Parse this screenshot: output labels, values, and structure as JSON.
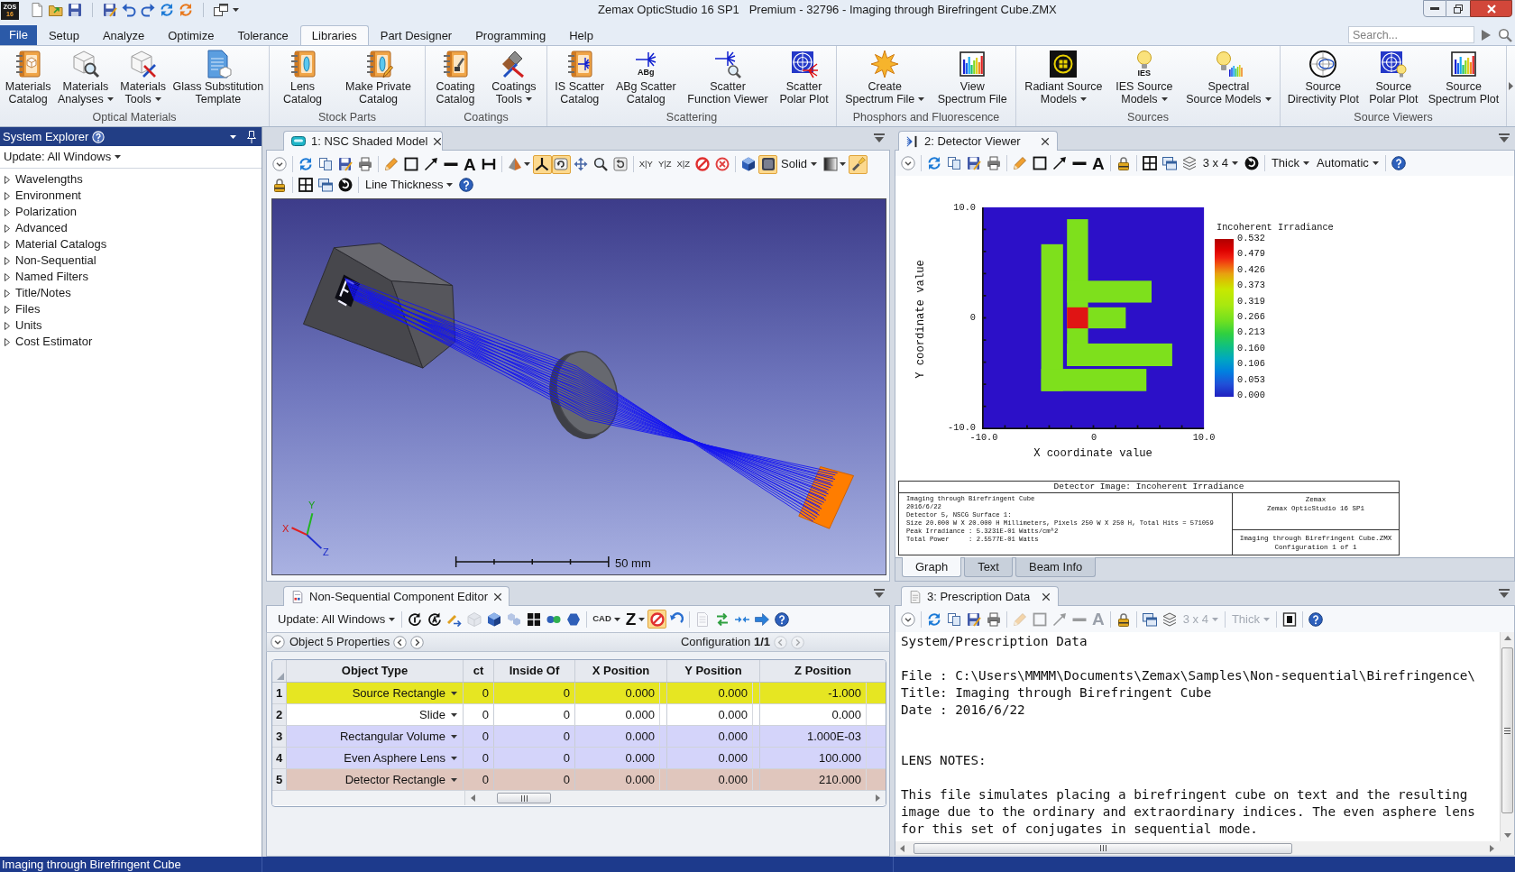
{
  "title_bar": {
    "logo": [
      "ZOS",
      "16"
    ],
    "title": "Zemax OpticStudio 16 SP1   Premium - 32796 - Imaging through Birefringent Cube.ZMX"
  },
  "menu_tabs": [
    {
      "label": "File",
      "kind": "file",
      "selected": false
    },
    {
      "label": "Setup",
      "kind": "tab",
      "selected": false
    },
    {
      "label": "Analyze",
      "kind": "tab",
      "selected": false
    },
    {
      "label": "Optimize",
      "kind": "tab",
      "selected": false
    },
    {
      "label": "Tolerance",
      "kind": "tab",
      "selected": false
    },
    {
      "label": "Libraries",
      "kind": "tab",
      "selected": true
    },
    {
      "label": "Part Designer",
      "kind": "tab",
      "selected": false
    },
    {
      "label": "Programming",
      "kind": "tab",
      "selected": false
    },
    {
      "label": "Help",
      "kind": "tab",
      "selected": false
    }
  ],
  "search": {
    "placeholder": "Search..."
  },
  "ribbon_groups": [
    {
      "label": "Optical Materials",
      "buttons": [
        {
          "lines": [
            "Materials",
            "Catalog"
          ]
        },
        {
          "lines": [
            "Materials",
            "Analyses"
          ],
          "dropdown": true
        },
        {
          "lines": [
            "Materials",
            "Tools"
          ],
          "dropdown": true
        },
        {
          "lines": [
            "Glass Substitution",
            "Template"
          ]
        }
      ]
    },
    {
      "label": "Stock Parts",
      "buttons": [
        {
          "lines": [
            "Lens",
            "Catalog"
          ]
        },
        {
          "lines": [
            "Make Private",
            "Catalog"
          ]
        }
      ]
    },
    {
      "label": "Coatings",
      "buttons": [
        {
          "lines": [
            "Coating",
            "Catalog"
          ]
        },
        {
          "lines": [
            "Coatings",
            "Tools"
          ],
          "dropdown": true
        }
      ]
    },
    {
      "label": "Scattering",
      "buttons": [
        {
          "lines": [
            "IS Scatter",
            "Catalog"
          ]
        },
        {
          "lines": [
            "ABg Scatter",
            "Catalog"
          ],
          "icon_text": "ABg"
        },
        {
          "lines": [
            "Scatter",
            "Function Viewer"
          ]
        },
        {
          "lines": [
            "Scatter",
            "Polar Plot"
          ]
        }
      ]
    },
    {
      "label": "Phosphors and Fluorescence",
      "buttons": [
        {
          "lines": [
            "Create",
            "Spectrum File"
          ],
          "dropdown": true
        },
        {
          "lines": [
            "View",
            "Spectrum File"
          ]
        }
      ]
    },
    {
      "label": "Sources",
      "buttons": [
        {
          "lines": [
            "Radiant Source",
            "Models"
          ],
          "dropdown": true
        },
        {
          "lines": [
            "IES Source",
            "Models"
          ],
          "dropdown": true,
          "icon_text": "IES"
        },
        {
          "lines": [
            "Spectral",
            "Source Models"
          ],
          "dropdown": true
        }
      ]
    },
    {
      "label": "Source Viewers",
      "buttons": [
        {
          "lines": [
            "Source",
            "Directivity Plot"
          ]
        },
        {
          "lines": [
            "Source",
            "Polar Plot"
          ]
        },
        {
          "lines": [
            "Source",
            "Spectrum Plot"
          ]
        }
      ]
    }
  ],
  "system_explorer": {
    "title": "System Explorer",
    "update": "Update: All Windows",
    "items": [
      {
        "label": "Wavelengths",
        "expanded": false
      },
      {
        "label": "Environment",
        "expanded": false
      },
      {
        "label": "Polarization",
        "expanded": false
      },
      {
        "label": "Advanced",
        "expanded": false
      },
      {
        "label": "Material Catalogs",
        "expanded": false
      },
      {
        "label": "Non-Sequential",
        "expanded": false
      },
      {
        "label": "Named Filters",
        "expanded": false
      },
      {
        "label": "Title/Notes",
        "expanded": false
      },
      {
        "label": "Files",
        "expanded": false
      },
      {
        "label": "Units",
        "expanded": false
      },
      {
        "label": "Cost Estimator",
        "expanded": false
      }
    ]
  },
  "nsc_view": {
    "tab": "1: NSC Shaded Model",
    "toolbar_rows": [
      [
        {
          "kind": "icon"
        },
        {
          "kind": "separator"
        },
        {
          "kind": "icon"
        },
        {
          "kind": "icon"
        },
        {
          "kind": "icon"
        },
        {
          "kind": "icon"
        },
        {
          "kind": "separator"
        },
        {
          "kind": "icon"
        },
        {
          "kind": "icon"
        },
        {
          "kind": "icon"
        },
        {
          "kind": "icon"
        },
        {
          "kind": "glyph",
          "label": "A"
        },
        {
          "kind": "icon"
        },
        {
          "kind": "separator"
        },
        {
          "kind": "icon",
          "dropdown": true
        },
        {
          "kind": "icon",
          "on": true
        },
        {
          "kind": "icon",
          "on": true
        },
        {
          "kind": "icon"
        },
        {
          "kind": "icon"
        },
        {
          "kind": "icon"
        },
        {
          "kind": "separator"
        },
        {
          "kind": "mini",
          "label": "X|Y"
        },
        {
          "kind": "mini",
          "label": "Y|Z"
        },
        {
          "kind": "mini",
          "label": "X|Z"
        },
        {
          "kind": "icon"
        },
        {
          "kind": "icon"
        },
        {
          "kind": "separator"
        },
        {
          "kind": "icon"
        },
        {
          "kind": "icon",
          "on": true
        },
        {
          "kind": "text",
          "label": "Solid",
          "dropdown": true
        },
        {
          "kind": "icon",
          "dropdown": true
        },
        {
          "kind": "icon",
          "on": true
        }
      ],
      [
        {
          "kind": "icon"
        },
        {
          "kind": "separator"
        },
        {
          "kind": "icon"
        },
        {
          "kind": "icon"
        },
        {
          "kind": "icon"
        },
        {
          "kind": "separator"
        },
        {
          "kind": "text",
          "label": "Line Thickness",
          "dropdown": true
        },
        {
          "kind": "icon"
        }
      ]
    ],
    "scale_label": "50 mm",
    "triad": {
      "x": "X",
      "y": "Y",
      "z": "Z"
    }
  },
  "detector_viewer": {
    "tab": "2: Detector Viewer",
    "toolbar": [
      {
        "kind": "icon"
      },
      {
        "kind": "separator"
      },
      {
        "kind": "icon"
      },
      {
        "kind": "icon"
      },
      {
        "kind": "icon"
      },
      {
        "kind": "icon"
      },
      {
        "kind": "separator"
      },
      {
        "kind": "icon"
      },
      {
        "kind": "icon"
      },
      {
        "kind": "icon"
      },
      {
        "kind": "icon"
      },
      {
        "kind": "glyph",
        "label": "A"
      },
      {
        "kind": "separator"
      },
      {
        "kind": "icon"
      },
      {
        "kind": "separator"
      },
      {
        "kind": "icon"
      },
      {
        "kind": "icon"
      },
      {
        "kind": "icon"
      },
      {
        "kind": "text",
        "label": "3 x 4",
        "dropdown": true
      },
      {
        "kind": "icon"
      },
      {
        "kind": "separator"
      },
      {
        "kind": "text",
        "label": "Thick",
        "dropdown": true
      },
      {
        "kind": "text",
        "label": "Automatic",
        "dropdown": true
      },
      {
        "kind": "separator"
      },
      {
        "kind": "icon"
      }
    ],
    "plot": {
      "y_label": "Y coordinate value",
      "x_label": "X coordinate value",
      "y_ticks": [
        "10.0",
        "0",
        "-10.0"
      ],
      "x_ticks": [
        "-10.0",
        "0",
        "10.0"
      ],
      "legend_title": "Incoherent Irradiance",
      "legend_values": [
        "0.532",
        "0.479",
        "0.426",
        "0.373",
        "0.319",
        "0.266",
        "0.213",
        "0.160",
        "0.106",
        "0.053",
        "0.000"
      ]
    },
    "info": {
      "title": "Detector Image: Incoherent Irradiance",
      "lines": [
        "Imaging through Birefringent Cube",
        "2016/6/22",
        "Detector 5, NSCG Surface 1:",
        "Size 20.000 W X 20.000 H Millimeters, Pixels 250 W X 250 H, Total Hits = 571059",
        "Peak Irradiance : 5.3231E-01 Watts/cm^2",
        "Total Power     : 2.5577E-01 Watts"
      ],
      "company": [
        "Zemax",
        "Zemax OpticStudio 16 SP1"
      ],
      "file": [
        "Imaging through Birefringent Cube.ZMX",
        "Configuration 1 of 1"
      ]
    },
    "view_tabs": [
      {
        "label": "Graph",
        "selected": true
      },
      {
        "label": "Text",
        "selected": false
      },
      {
        "label": "Beam Info",
        "selected": false
      }
    ]
  },
  "editor": {
    "tab": "Non-Sequential Component Editor",
    "toolbar": [
      {
        "kind": "text",
        "label": "Update: All Windows",
        "dropdown": true
      },
      {
        "kind": "separator"
      },
      {
        "kind": "icon"
      },
      {
        "kind": "icon"
      },
      {
        "kind": "icon"
      },
      {
        "kind": "icon",
        "disabled": true
      },
      {
        "kind": "icon"
      },
      {
        "kind": "icon",
        "disabled": true
      },
      {
        "kind": "icon"
      },
      {
        "kind": "icon"
      },
      {
        "kind": "icon"
      },
      {
        "kind": "separator"
      },
      {
        "kind": "mini",
        "label": "CAD",
        "dropdown": true
      },
      {
        "kind": "glyph",
        "label": "Z",
        "dropdown": true
      },
      {
        "kind": "icon",
        "on": true
      },
      {
        "kind": "icon"
      },
      {
        "kind": "separator"
      },
      {
        "kind": "icon",
        "disabled": true
      },
      {
        "kind": "icon"
      },
      {
        "kind": "icon"
      },
      {
        "kind": "icon"
      },
      {
        "kind": "icon"
      }
    ],
    "properties": {
      "label": "Object 5 Properties",
      "object_nav": [
        {
          "disabled": false
        },
        {
          "disabled": false
        }
      ],
      "configuration": "Configuration **1/1**",
      "config_nav": [
        {
          "disabled": true
        },
        {
          "disabled": true
        }
      ]
    },
    "columns": [
      "Object Type",
      "ct",
      "Inside Of",
      "X Position",
      "Y Position",
      "Z Position"
    ],
    "rows": [
      {
        "number": "1",
        "cells": [
          "Source Rectangle",
          "0",
          "0",
          "0.000",
          "0.000",
          "-1.000"
        ],
        "color": "#e6e622"
      },
      {
        "number": "2",
        "cells": [
          "Slide",
          "0",
          "0",
          "0.000",
          "0.000",
          "0.000"
        ],
        "color": "#ffffff"
      },
      {
        "number": "3",
        "cells": [
          "Rectangular Volume",
          "0",
          "0",
          "0.000",
          "0.000",
          "1.000E-03"
        ],
        "color": "#d4d4fa"
      },
      {
        "number": "4",
        "cells": [
          "Even Asphere Lens",
          "0",
          "0",
          "0.000",
          "0.000",
          "100.000"
        ],
        "color": "#d4d4fa"
      },
      {
        "number": "5",
        "cells": [
          "Detector Rectangle",
          "0",
          "0",
          "0.000",
          "0.000",
          "210.000"
        ],
        "color": "#e0c6bd"
      }
    ]
  },
  "prescription": {
    "tab": "3: Prescription Data",
    "toolbar": [
      {
        "kind": "icon"
      },
      {
        "kind": "separator"
      },
      {
        "kind": "icon"
      },
      {
        "kind": "icon"
      },
      {
        "kind": "icon"
      },
      {
        "kind": "icon"
      },
      {
        "kind": "separator"
      },
      {
        "kind": "icon",
        "disabled": true
      },
      {
        "kind": "icon",
        "disabled": true
      },
      {
        "kind": "icon",
        "disabled": true
      },
      {
        "kind": "icon",
        "disabled": true
      },
      {
        "kind": "glyph",
        "label": "A",
        "disabled": true
      },
      {
        "kind": "separator"
      },
      {
        "kind": "icon"
      },
      {
        "kind": "separator"
      },
      {
        "kind": "icon"
      },
      {
        "kind": "icon"
      },
      {
        "kind": "text",
        "label": "3 x 4",
        "dropdown": true,
        "disabled": true
      },
      {
        "kind": "separator"
      },
      {
        "kind": "text",
        "label": "Thick",
        "dropdown": true,
        "disabled": true
      },
      {
        "kind": "separator"
      },
      {
        "kind": "icon"
      },
      {
        "kind": "separator"
      },
      {
        "kind": "icon"
      }
    ],
    "report": {
      "heading": "System/Prescription Data",
      "file": "File : C:\\Users\\MMMM\\Documents\\Zemax\\Samples\\Non-sequential\\Birefringence\\",
      "title": "Title: Imaging through Birefringent Cube",
      "date": "Date : 2016/6/22",
      "notes_heading": "LENS NOTES:",
      "notes": "This file simulates placing a birefringent cube on text and the resulting\nimage due to the ordinary and extraordinary indices. The even asphere lens\nfor this set of conjugates in sequential mode."
    }
  },
  "status_bar": {
    "text": "Imaging through Birefringent Cube"
  }
}
